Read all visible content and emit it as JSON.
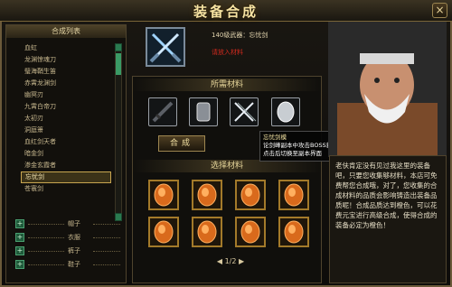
{
  "window": {
    "title": "装备合成",
    "close_label": "×"
  },
  "list": {
    "header": "合成列表",
    "items": [
      "血虹",
      "龙渊惊魂刀",
      "璧海鞘生笛",
      "赤霄龙渊剑",
      "幽冥刃",
      "九霄白帝刀",
      "太初刃",
      "洞庭箫",
      "血红剑天者",
      "暗金剑",
      "渗金玄霞者",
      "忘忧剑",
      "苍寰剑"
    ],
    "selected_index": 11,
    "categories": [
      "帽子",
      "衣服",
      "裤子",
      "鞋子"
    ]
  },
  "target": {
    "name": "140级武器：忘忧剑",
    "hint": "请放入材料"
  },
  "materials": {
    "title": "所需材料"
  },
  "actions": {
    "compose_label": "合成"
  },
  "select": {
    "title": "选择材料",
    "page": "1/2",
    "prev": "◀",
    "next": "▶"
  },
  "tooltip": {
    "title": "忘忧剑模",
    "line1": "论剑峰副本中攻击BOSS获得",
    "line2": "点击后切换至副本界面"
  },
  "dialog": {
    "text": "老伕肯定没有见过我这里的装备吧，只要您收集够材料，本店可免费帮您合成哦，对了，您收集的合成材料的品质会影响铸造出装备品质呢！合成品质达到橙色，可以花费元宝进行高级合成，使得合成的装备必定为橙色！"
  },
  "colors": {
    "accent": "#c8a650",
    "warning": "#d12a1e",
    "frame": "#6b5a3a"
  }
}
